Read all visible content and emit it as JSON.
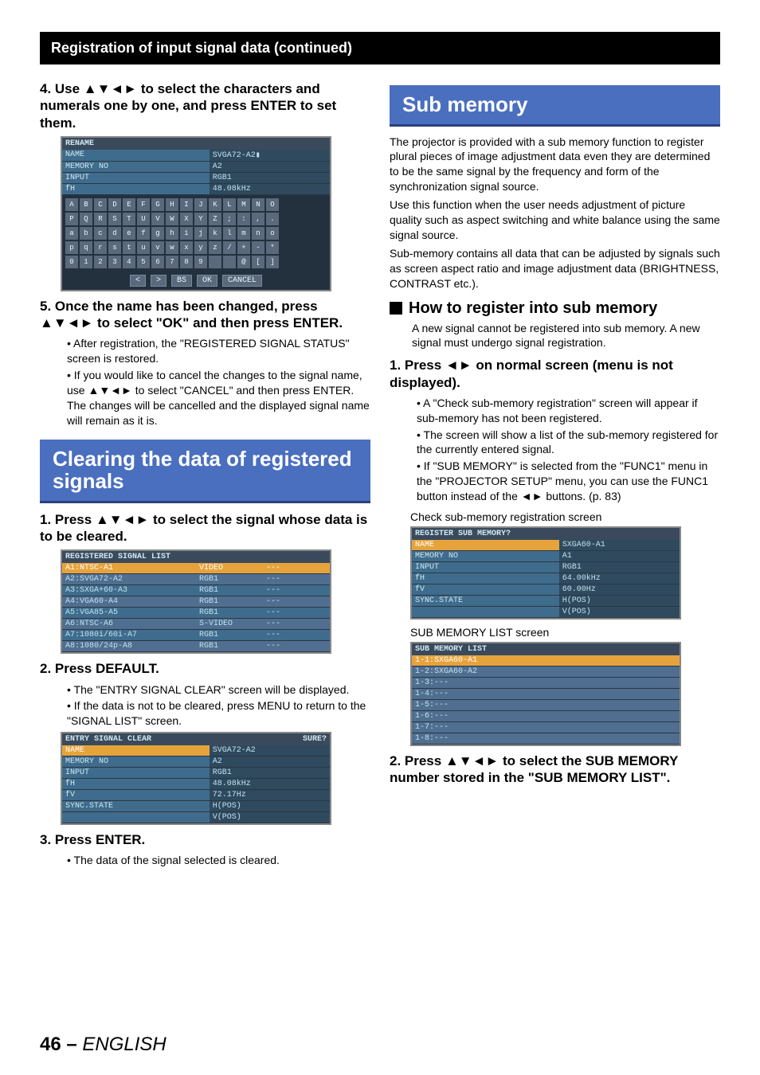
{
  "header_title": "Registration of input signal data (continued)",
  "left": {
    "step4": {
      "text": "4.  Use ▲▼◄► to select the characters and numerals one by one, and press ENTER to set them."
    },
    "rename_osd": {
      "title": "RENAME",
      "rows": [
        {
          "k": "NAME",
          "v": "SVGA72-A2▮"
        },
        {
          "k": "MEMORY NO",
          "v": "A2"
        },
        {
          "k": "INPUT",
          "v": "RGB1"
        },
        {
          "k": "fH",
          "v": "48.08kHz"
        }
      ],
      "grid": [
        [
          "A",
          "B",
          "C",
          "D",
          "E",
          "F",
          "G",
          "H",
          "I",
          "J",
          "K",
          "L",
          "M",
          "N",
          "O"
        ],
        [
          "P",
          "Q",
          "R",
          "S",
          "T",
          "U",
          "V",
          "W",
          "X",
          "Y",
          "Z",
          ";",
          ":",
          ",",
          "."
        ],
        [
          "a",
          "b",
          "c",
          "d",
          "e",
          "f",
          "g",
          "h",
          "i",
          "j",
          "k",
          "l",
          "m",
          "n",
          "o"
        ],
        [
          "p",
          "q",
          "r",
          "s",
          "t",
          "u",
          "v",
          "w",
          "x",
          "y",
          "z",
          "/",
          "+",
          "-",
          "*"
        ],
        [
          "0",
          "1",
          "2",
          "3",
          "4",
          "5",
          "6",
          "7",
          "8",
          "9",
          " ",
          " ",
          "@",
          "[",
          "]"
        ]
      ],
      "buttons": [
        "<",
        ">",
        "BS",
        "OK",
        "CANCEL"
      ]
    },
    "step5": {
      "text": "5.  Once the name has been changed, press ▲▼◄► to select \"OK\" and then press ENTER.",
      "b1": "After registration, the \"REGISTERED SIGNAL STATUS\" screen is restored.",
      "b2": "If you would like to cancel the changes to the signal name, use ▲▼◄► to select \"CANCEL\" and then press ENTER. The changes will be cancelled and the displayed signal name will remain as it is."
    },
    "blue1": "Clearing the data of registered signals",
    "step1b": "1.  Press ▲▼◄► to select the signal whose data is to be cleared.",
    "sig_list": {
      "head": "REGISTERED SIGNAL LIST",
      "rows": [
        {
          "a": "A1:NTSC-A1",
          "b": "VIDEO",
          "c": "---",
          "sel": true
        },
        {
          "a": "A2:SVGA72-A2",
          "b": "RGB1",
          "c": "---"
        },
        {
          "a": "A3:SXGA+60-A3",
          "b": "RGB1",
          "c": "---"
        },
        {
          "a": "A4:VGA60-A4",
          "b": "RGB1",
          "c": "---"
        },
        {
          "a": "A5:VGA85-A5",
          "b": "RGB1",
          "c": "---"
        },
        {
          "a": "A6:NTSC-A6",
          "b": "S-VIDEO",
          "c": "---"
        },
        {
          "a": "A7:1080i/60i-A7",
          "b": "RGB1",
          "c": "---"
        },
        {
          "a": "A8:1080/24p-A8",
          "b": "RGB1",
          "c": "---"
        }
      ]
    },
    "step2b": {
      "head": "2.  Press DEFAULT.",
      "b1": "The \"ENTRY SIGNAL CLEAR\" screen will be displayed.",
      "b2": "If the data is not to be cleared, press MENU to return to the \"SIGNAL LIST\" screen."
    },
    "clear_osd": {
      "head": "ENTRY SIGNAL CLEAR",
      "sure": "SURE?",
      "rows": [
        {
          "k": "NAME",
          "v": "SVGA72-A2",
          "sel": true
        },
        {
          "k": "MEMORY NO",
          "v": "A2"
        },
        {
          "k": "INPUT",
          "v": "RGB1"
        },
        {
          "k": "fH",
          "v": "48.08kHz"
        },
        {
          "k": "fV",
          "v": "72.17Hz"
        },
        {
          "k": "SYNC.STATE",
          "v": "H(POS)"
        },
        {
          "k": "",
          "v": "V(POS)"
        }
      ]
    },
    "step3b": {
      "head": "3.  Press ENTER.",
      "b1": "The data of the signal selected is cleared."
    }
  },
  "right": {
    "blue": "Sub memory",
    "intro1": "The projector is provided with a sub memory function to register plural pieces of image adjustment data even they are determined to be the same signal by the frequency and form of the synchronization signal source.",
    "intro2": "Use this function when the user needs adjustment of picture quality such as aspect switching and white balance using the same signal source.",
    "intro3": "Sub-memory contains all data that can be adjusted by signals such as screen aspect ratio and image adjustment data (BRIGHTNESS, CONTRAST etc.).",
    "h2": "How to register into sub memory",
    "h2_body": "A new signal cannot be registered into sub memory. A new signal must undergo signal registration.",
    "r1": {
      "head": "1.  Press ◄► on normal screen (menu is not displayed).",
      "b1": "A \"Check sub-memory registration\" screen will appear if sub-memory has not been registered.",
      "b2": "The screen will show a list of the sub-memory registered for the currently entered signal.",
      "b3": "If \"SUB MEMORY\" is selected from the \"FUNC1\" menu in the \"PROJECTOR SETUP\" menu, you can use the FUNC1 button instead of the ◄► buttons. (p. 83)"
    },
    "cap1": "Check sub-memory registration screen",
    "reg_osd": {
      "head": "REGISTER SUB MEMORY?",
      "rows": [
        {
          "k": "NAME",
          "v": "SXGA60-A1",
          "sel": true
        },
        {
          "k": "MEMORY NO",
          "v": "A1"
        },
        {
          "k": "INPUT",
          "v": "RGB1"
        },
        {
          "k": "fH",
          "v": "64.00kHz"
        },
        {
          "k": "fV",
          "v": "60.00Hz"
        },
        {
          "k": "SYNC.STATE",
          "v": "H(POS)"
        },
        {
          "k": "",
          "v": "V(POS)"
        }
      ]
    },
    "cap2": "SUB MEMORY LIST screen",
    "sml": {
      "head": "SUB MEMORY LIST",
      "rows": [
        {
          "t": "1-1:SXGA60-A1",
          "sel": true
        },
        {
          "t": "1-2:SXGA60-A2"
        },
        {
          "t": "1-3:---"
        },
        {
          "t": "1-4:---"
        },
        {
          "t": "1-5:---"
        },
        {
          "t": "1-6:---"
        },
        {
          "t": "1-7:---"
        },
        {
          "t": "1-8:---"
        }
      ]
    },
    "r2": "2.  Press ▲▼◄► to select the SUB MEMORY number stored in the \"SUB MEMORY LIST\"."
  },
  "footer": {
    "page": "46",
    "dash": " – ",
    "lang": "ENGLISH"
  }
}
